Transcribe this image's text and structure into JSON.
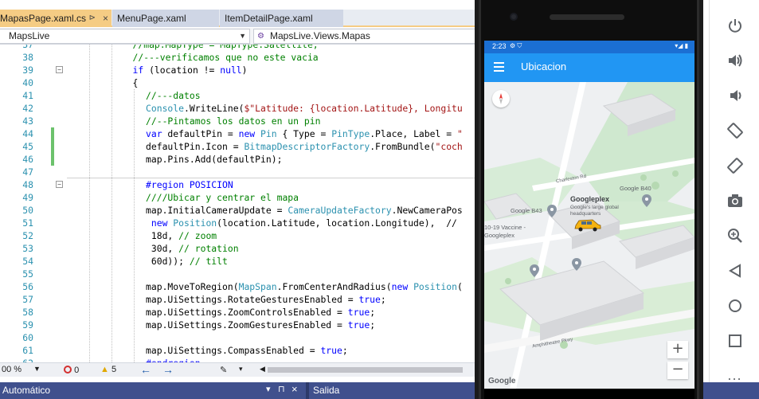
{
  "ide": {
    "tabs": [
      {
        "label": "MapasPage.xaml.cs",
        "active": true,
        "pin": "⊳",
        "close": "×"
      },
      {
        "label": "MenuPage.xaml",
        "active": false
      },
      {
        "label": "ItemDetailPage.xaml",
        "active": false
      }
    ],
    "nav": {
      "project_combo": "MapsLive",
      "class_combo": "MapsLive.Views.Mapas"
    },
    "code_lines": [
      {
        "n": "37",
        "text": "//map.MapType = MapType.Satellite;"
      },
      {
        "n": "38",
        "text": "//---verificamos que no este vacia"
      },
      {
        "n": "39",
        "text": "if (location != null)"
      },
      {
        "n": "40",
        "text": "{"
      },
      {
        "n": "41",
        "text": "//---datos"
      },
      {
        "n": "42",
        "text": "Console.WriteLine($\"Latitude: {location.Latitude}, Longitu"
      },
      {
        "n": "43",
        "text": "//--Pintamos los datos en un pin"
      },
      {
        "n": "44",
        "text": "var defaultPin = new Pin { Type = PinType.Place, Label = \""
      },
      {
        "n": "45",
        "text": "defaultPin.Icon = BitmapDescriptorFactory.FromBundle(\"coch"
      },
      {
        "n": "46",
        "text": "map.Pins.Add(defaultPin);"
      },
      {
        "n": "47",
        "text": ""
      },
      {
        "n": "48",
        "text": "#region POSICION"
      },
      {
        "n": "49",
        "text": "////Ubicar y centrar el mapa"
      },
      {
        "n": "50",
        "text": "map.InitialCameraUpdate = CameraUpdateFactory.NewCameraPos"
      },
      {
        "n": "51",
        "text": " new Position(location.Latitude, location.Longitude),  //"
      },
      {
        "n": "52",
        "text": " 18d, // zoom"
      },
      {
        "n": "53",
        "text": " 30d, // rotation"
      },
      {
        "n": "54",
        "text": " 60d)); // tilt"
      },
      {
        "n": "55",
        "text": ""
      },
      {
        "n": "56",
        "text": "map.MoveToRegion(MapSpan.FromCenterAndRadius(new Position("
      },
      {
        "n": "57",
        "text": "map.UiSettings.RotateGesturesEnabled = true;"
      },
      {
        "n": "58",
        "text": "map.UiSettings.ZoomControlsEnabled = true;"
      },
      {
        "n": "59",
        "text": "map.UiSettings.ZoomGesturesEnabled = true;"
      },
      {
        "n": "60",
        "text": ""
      },
      {
        "n": "61",
        "text": "map.UiSettings.CompassEnabled = true;"
      },
      {
        "n": "62",
        "text": "#endregion"
      }
    ],
    "status": {
      "zoom": "00 %",
      "errors": "0",
      "warnings": "5",
      "col": "3"
    },
    "bottom_panel": {
      "left_title": "Automático",
      "right_title": "Salida",
      "pin": "⊓",
      "close": "×",
      "arrow": "▾"
    }
  },
  "phone": {
    "status_time": "2:23",
    "status_icons": "⚙ ⛉",
    "status_right": "▾◢ ▮",
    "app_title": "Ubicacion",
    "map_labels": {
      "googleplex": "Googleplex",
      "googleplex_sub": "Google's large global headquarters",
      "google_b40": "Google B40",
      "google_b43": "Google B43",
      "vaccine": "10-19 Vaccine - Googleplex",
      "street1": "Charleston Rd",
      "street2": "Amphitheatre Pkwy",
      "attribution": "Google"
    },
    "zoom_in": "+",
    "zoom_out": "−"
  },
  "emulator": {
    "buttons": [
      "power-icon",
      "volume-up-icon",
      "volume-down-icon",
      "rotate-left-icon",
      "rotate-right-icon",
      "camera-icon",
      "zoom-icon",
      "back-icon",
      "home-icon",
      "overview-icon",
      "more-icon"
    ],
    "more": "..."
  }
}
